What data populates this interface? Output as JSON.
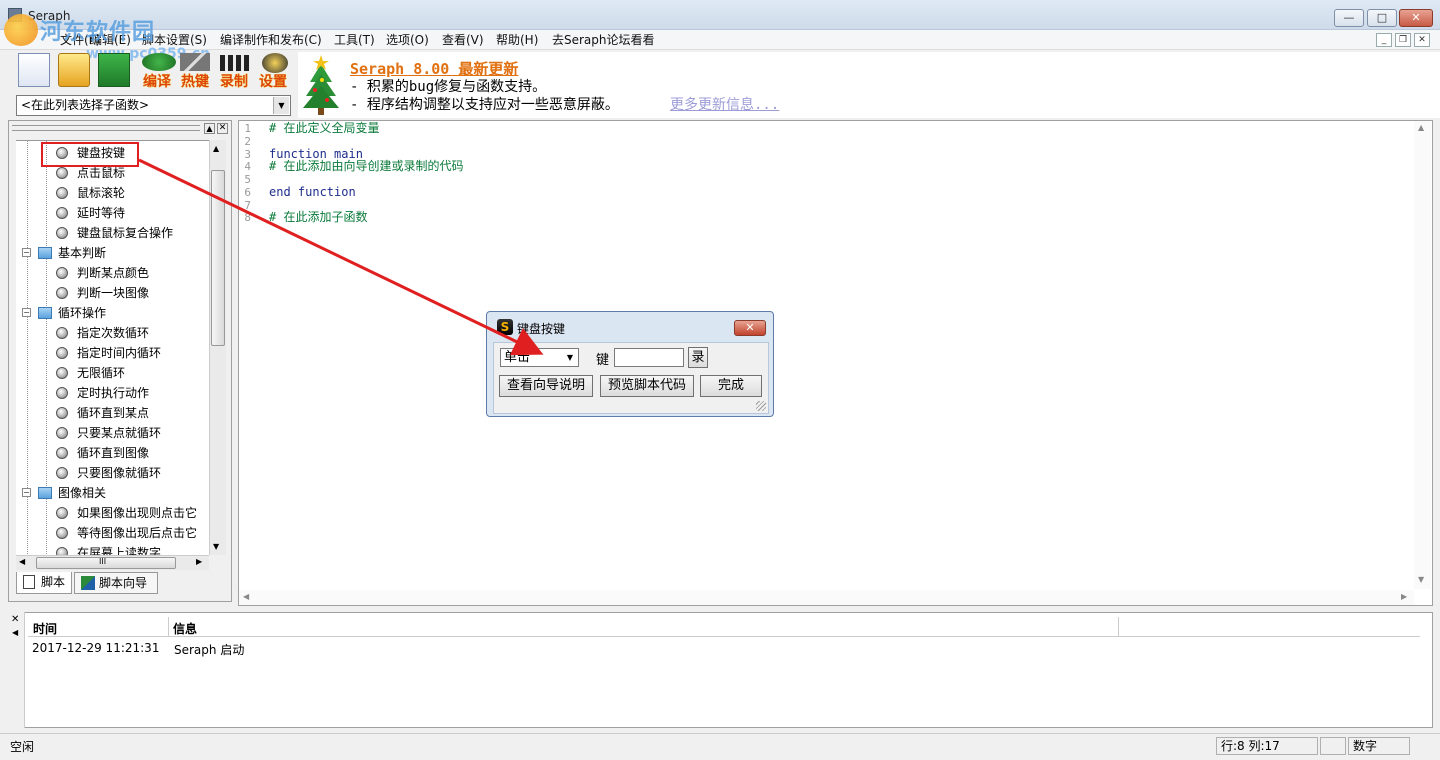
{
  "window": {
    "title": "Seraph",
    "minimize_label": "▭",
    "maximize_label": "□",
    "close_label": "✕"
  },
  "watermark": {
    "text": "河东软件园",
    "url": "www.pc0359.cn"
  },
  "menu": {
    "items": [
      "文件(F)",
      "编辑(E)",
      "脚本设置(S)",
      "编译制作和发布(C)",
      "工具(T)",
      "选项(O)",
      "查看(V)",
      "帮助(H)",
      "去Seraph论坛看看"
    ]
  },
  "toolbar": {
    "compile_label": "编译",
    "hotkey_label": "热键",
    "record_label": "录制",
    "settings_label": "设置"
  },
  "function_select": {
    "value": "<在此列表选择子函数>"
  },
  "news": {
    "title": "Seraph 8.00 最新更新",
    "line1": "- 积累的bug修复与函数支持。",
    "line2": "- 程序结构调整以支持应对一些恶意屏蔽。",
    "more_link": "更多更新信息..."
  },
  "tree": {
    "items": [
      {
        "label": "键盘按键"
      },
      {
        "label": "点击鼠标"
      },
      {
        "label": "鼠标滚轮"
      },
      {
        "label": "延时等待"
      },
      {
        "label": "键盘鼠标复合操作"
      },
      {
        "label": "基本判断"
      },
      {
        "label": "判断某点颜色"
      },
      {
        "label": "判断一块图像"
      },
      {
        "label": "循环操作"
      },
      {
        "label": "指定次数循环"
      },
      {
        "label": "指定时间内循环"
      },
      {
        "label": "无限循环"
      },
      {
        "label": "定时执行动作"
      },
      {
        "label": "循环直到某点"
      },
      {
        "label": "只要某点就循环"
      },
      {
        "label": "循环直到图像"
      },
      {
        "label": "只要图像就循环"
      },
      {
        "label": "图像相关"
      },
      {
        "label": "如果图像出现则点击它"
      },
      {
        "label": "等待图像出现后点击它"
      },
      {
        "label": "在屏幕上读数字"
      }
    ],
    "hscroll_label": "III"
  },
  "tabs": {
    "script": "脚本",
    "wizard": "脚本向导"
  },
  "editor": {
    "lines": [
      {
        "no": "1",
        "text": "# 在此定义全局变量"
      },
      {
        "no": "2",
        "text": ""
      },
      {
        "no": "3",
        "text": "function main"
      },
      {
        "no": "4",
        "text": "# 在此添加由向导创建或录制的代码"
      },
      {
        "no": "5",
        "text": ""
      },
      {
        "no": "6",
        "text": "end function"
      },
      {
        "no": "7",
        "text": ""
      },
      {
        "no": "8",
        "text": "# 在此添加子函数"
      }
    ]
  },
  "dialog": {
    "title": "键盘按键",
    "icon_letter": "S",
    "close_label": "✕",
    "mode_value": "单击",
    "key_label": "键",
    "key_value": "",
    "record_label": "录",
    "help_button": "查看向导说明",
    "preview_button": "预览脚本代码",
    "done_button": "完成"
  },
  "log": {
    "columns": [
      "时间",
      "信息"
    ],
    "rows": [
      {
        "time": "2017-12-29 11:21:31",
        "info": "Seraph 启动"
      }
    ]
  },
  "status": {
    "state": "空闲",
    "position": "行:8  列:17",
    "mode": "数字"
  },
  "colors": {
    "annotation_red": "#e02020",
    "news_title": "#e07010",
    "comment_green": "#0a7a3a",
    "keyword_blue": "#1e2e8c"
  }
}
